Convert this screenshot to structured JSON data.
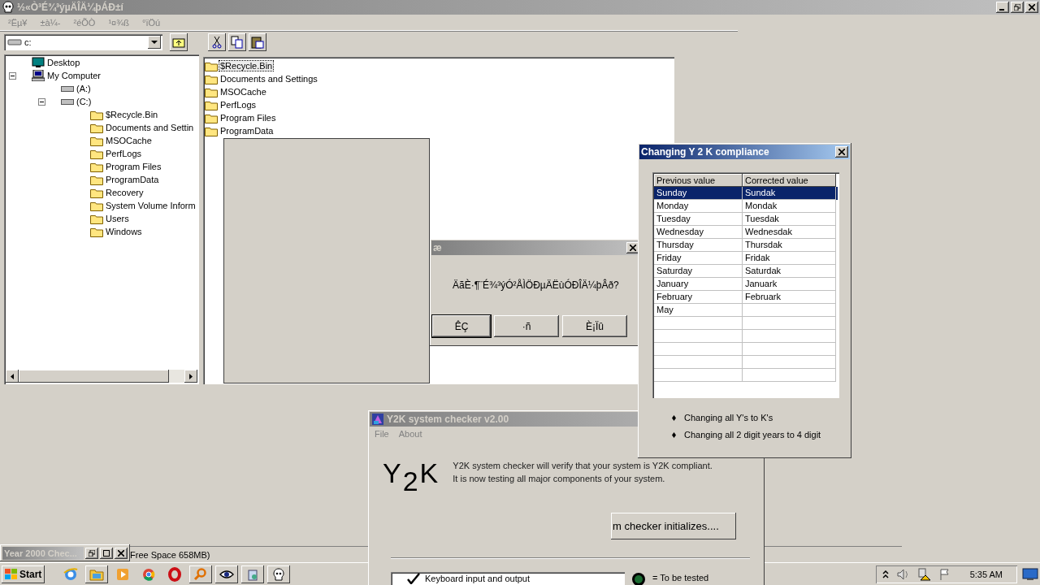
{
  "main_window": {
    "title": "½«Ò³É¾³ýµÄÎÄ¼þÁÐ±í",
    "menu": [
      "²Ëµ¥",
      "±à¼-",
      "²éÕÒ",
      "¹¤¾ß",
      "°ïÖú"
    ],
    "drive_select": {
      "value": "c:"
    },
    "tree": [
      {
        "label": "Desktop",
        "kind": "desktop"
      },
      {
        "label": "My Computer",
        "kind": "computer",
        "expanded": true,
        "children": [
          {
            "label": "(A:)",
            "kind": "drive"
          },
          {
            "label": "(C:)",
            "kind": "drive",
            "expanded": true,
            "children": [
              {
                "label": "$Recycle.Bin",
                "kind": "folder"
              },
              {
                "label": "Documents and Settin",
                "kind": "folder"
              },
              {
                "label": "MSOCache",
                "kind": "folder"
              },
              {
                "label": "PerfLogs",
                "kind": "folder"
              },
              {
                "label": "Program Files",
                "kind": "folder"
              },
              {
                "label": "ProgramData",
                "kind": "folder"
              },
              {
                "label": "Recovery",
                "kind": "folder"
              },
              {
                "label": "System Volume Inform",
                "kind": "folder"
              },
              {
                "label": "Users",
                "kind": "folder"
              },
              {
                "label": "Windows",
                "kind": "folder"
              }
            ]
          }
        ]
      }
    ],
    "files": [
      {
        "name": "$Recycle.Bin",
        "selected": true
      },
      {
        "name": "Documents and Settings",
        "selected": false
      },
      {
        "name": "MSOCache",
        "selected": false
      },
      {
        "name": "PerfLogs",
        "selected": false
      },
      {
        "name": "Program Files",
        "selected": false
      },
      {
        "name": "ProgramData",
        "selected": false
      }
    ],
    "status": "Free Space 658MB)"
  },
  "message_box": {
    "title": "æ",
    "message": "ÄãÈ·¶¨É¾³ýÓ²ÅÌÖÐµÄËùÓÐÎÄ¼þÂð?",
    "buttons": [
      {
        "label": "ÊÇ",
        "default": true
      },
      {
        "label": "·ñ",
        "default": false
      },
      {
        "label": "È¡Ïû",
        "default": false
      }
    ]
  },
  "compliance_dialog": {
    "title": "Changing Y 2 K compliance",
    "columns": [
      "Previous value",
      "Corrected value"
    ],
    "rows": [
      {
        "previous": "Sunday",
        "corrected": "Sundak",
        "selected": true
      },
      {
        "previous": "Monday",
        "corrected": "Mondak",
        "selected": false
      },
      {
        "previous": "Tuesday",
        "corrected": "Tuesdak",
        "selected": false
      },
      {
        "previous": "Wednesday",
        "corrected": "Wednesdak",
        "selected": false
      },
      {
        "previous": "Thursday",
        "corrected": "Thursdak",
        "selected": false
      },
      {
        "previous": "Friday",
        "corrected": "Fridak",
        "selected": false
      },
      {
        "previous": "Saturday",
        "corrected": "Saturdak",
        "selected": false
      },
      {
        "previous": "January",
        "corrected": "Januark",
        "selected": false
      },
      {
        "previous": "February",
        "corrected": "Februark",
        "selected": false
      },
      {
        "previous": "May",
        "selected": false
      }
    ],
    "notes": [
      "Changing all Y's to K's",
      "Changing all 2 digit years to 4 digit"
    ]
  },
  "checker": {
    "title": "Y2K system checker v2.00",
    "menu": [
      "File",
      "About"
    ],
    "logo": "Y$_{2}$K",
    "description": [
      "Y2K system checker will verify that your system is Y2K compliant.",
      "It is now testing all major components of your system."
    ],
    "status_button": "m checker initializes....",
    "tests": [
      {
        "label": "Keyboard input and output",
        "checked": true
      }
    ],
    "legend": "= To be tested"
  },
  "minimized_window": {
    "title": "Year 2000 Chec..."
  },
  "taskbar": {
    "start": "Start",
    "items": [
      {
        "kind": "globe",
        "open": false
      },
      {
        "kind": "folder",
        "open": true
      },
      {
        "kind": "play",
        "open": false
      },
      {
        "kind": "wheel",
        "open": false
      },
      {
        "kind": "ring",
        "open": false
      },
      {
        "kind": "magnifier",
        "open": true
      },
      {
        "kind": "eye",
        "open": true
      },
      {
        "kind": "bin",
        "open": true
      },
      {
        "kind": "ghost",
        "open": true
      }
    ],
    "time": "5:35 AM"
  }
}
